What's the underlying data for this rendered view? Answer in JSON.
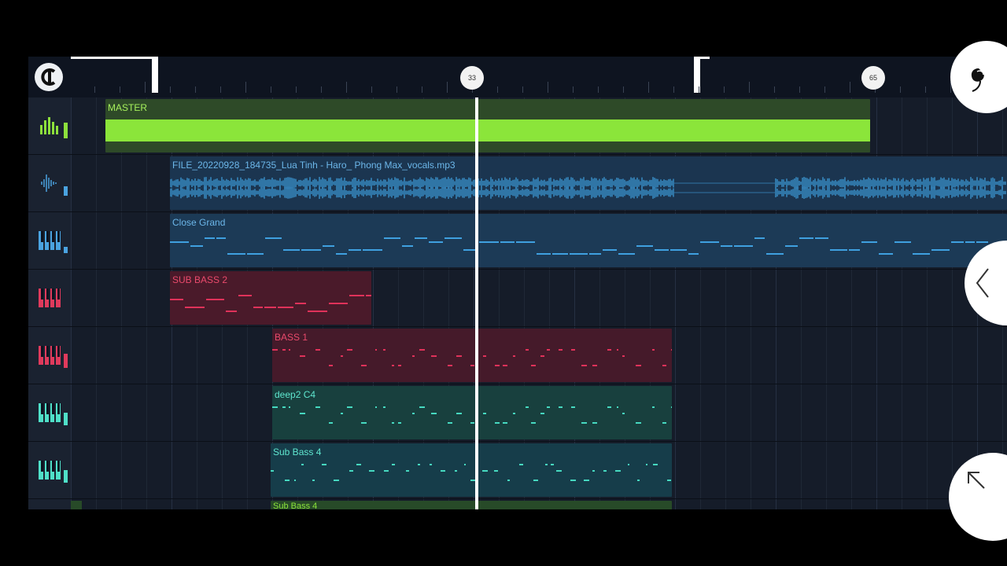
{
  "ruler": {
    "marker_1": "33",
    "marker_2": "65"
  },
  "tracks": [
    {
      "icon": "mixer-icon",
      "color": "#8de03c"
    },
    {
      "icon": "waveform-icon",
      "color": "#4aa3e0"
    },
    {
      "icon": "piano-icon",
      "color": "#4aa3e0"
    },
    {
      "icon": "piano-icon",
      "color": "#e03a5c"
    },
    {
      "icon": "piano-icon",
      "color": "#e03a5c"
    },
    {
      "icon": "piano-icon",
      "color": "#4fe0c8"
    },
    {
      "icon": "piano-icon",
      "color": "#4fe0c8"
    }
  ],
  "clips": {
    "master": "MASTER",
    "vocals": "FILE_20220928_184735_Lua Tinh - Haro_ Phong Max_vocals.mp3",
    "close_grand": "Close Grand",
    "sub_bass_2": "SUB BASS 2",
    "bass_1": "BASS 1",
    "deep2": "deep2 C4",
    "sub_bass_4": "Sub Bass 4",
    "sub_bass_4b": "Sub Bass 4"
  },
  "colors": {
    "master": "#8be53a",
    "vocals": "#3fa0e0",
    "piano_blue": "#3fa0e0",
    "red": "#e0325a",
    "teal": "#46d9c0",
    "green_label": "#8be53a"
  },
  "buttons": {
    "magnet": "magnet-icon",
    "fl_logo": "fl-studio-logo-icon",
    "back": "chevron-left-icon",
    "expand": "arrow-up-left-icon"
  }
}
